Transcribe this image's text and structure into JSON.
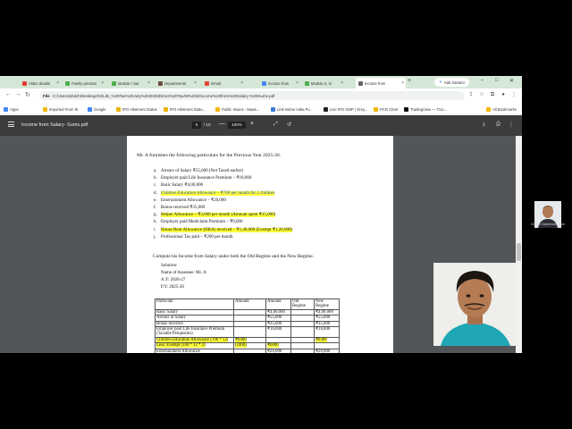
{
  "browser": {
    "tabs": [
      {
        "label": "Video details",
        "color": "#e53935"
      },
      {
        "label": "Family pension",
        "color": "#4caf50"
      },
      {
        "label": "Module I Sal",
        "color": "#4caf50"
      },
      {
        "label": "Departments",
        "color": "#6d4c41"
      },
      {
        "label": "Gmail",
        "color": "#ea4335"
      },
      {
        "label": "Income from",
        "color": "#4285f4"
      },
      {
        "label": "Module 2, In",
        "color": "#4caf50"
      },
      {
        "label": "Income from",
        "color": "#666666"
      }
    ],
    "new_tab": "+",
    "ask_gemini": "Ask Gemini",
    "url_chip": "File",
    "url": "C:/Users/phdch/Desktop/SOL/B_%20Tax%20July%202026/Direct%20Tax/M%202/Income%20from%20Salary-%20Sums.pdf",
    "bookmarks": [
      {
        "label": "Apps"
      },
      {
        "label": "Imported From IE"
      },
      {
        "label": "Google"
      },
      {
        "label": "IPO Allotment Status"
      },
      {
        "label": "IPO Allotment Statu..."
      },
      {
        "label": "Public Issues - Maas..."
      },
      {
        "label": "Link Intime India Pv..."
      },
      {
        "label": "Live IPO GMP | Grey..."
      },
      {
        "label": "PCR Chart"
      },
      {
        "label": "TradingView — Trac..."
      },
      {
        "label": "All Bookmarks"
      }
    ]
  },
  "pdf": {
    "title": "Income from Salary- Sums.pdf",
    "page_current": "6",
    "page_total": "/ 10",
    "zoom": "100%",
    "zoom_minus": "—",
    "zoom_plus": "+"
  },
  "document": {
    "intro": "Mr. A furnishes the following particulars for the Previous Year 2025-26.",
    "items": [
      {
        "label": "a.",
        "text": "Arrears of Salary ₹55,000 (Not Taxed earlier)",
        "hl": ""
      },
      {
        "label": "b.",
        "text": "Employer paid Life Insurance Premium – ₹18,000",
        "hl": ""
      },
      {
        "label": "c.",
        "text": "Basic Salary ₹4,00,000",
        "hl": ""
      },
      {
        "label": "d.",
        "text": "Children Education Allowance – ₹700 per month for 2 children",
        "hl": "yellow-blue"
      },
      {
        "label": "e.",
        "text": "Entertainment Allowance – ₹20,000",
        "hl": ""
      },
      {
        "label": "f.",
        "text": "Bonus received ₹35,000",
        "hl": ""
      },
      {
        "label": "g.",
        "text": "Helper Allowance – ₹3,000 per month (Amount spent ₹15,000)",
        "hl": "yellow"
      },
      {
        "label": "h.",
        "text": "Employer paid Mediclaim Premium – ₹9,000",
        "hl": ""
      },
      {
        "label": "i.",
        "text": "House Rent Allowance (HRA) received – ₹1,40,000 (Exempt ₹1,20,000)",
        "hl": "yellow"
      },
      {
        "label": "j.",
        "text": "Professional Tax paid – ₹200 per month",
        "hl": ""
      }
    ],
    "compute": "Compute his Income from Salary under both the Old Regime and the New Regime.",
    "solution": [
      "Solution:",
      "Name of Assessee: Mr. A",
      "A.Y: 2026-27",
      "P.Y: 2025-26"
    ],
    "table": {
      "headers": [
        "Particular",
        "Amount",
        "Amount",
        "Old Regime",
        "New Regime"
      ],
      "rows": [
        {
          "particular": "Basic Salary",
          "a1": "",
          "a2": "₹4,00,000",
          "old": "",
          "new": "₹4,00,000",
          "hl": ""
        },
        {
          "particular": "Arrears of Salary",
          "a1": "",
          "a2": "₹55,000",
          "old": "",
          "new": "₹55,000",
          "hl": ""
        },
        {
          "particular": "Bonus received",
          "a1": "",
          "a2": "₹35,000",
          "old": "",
          "new": "₹35,000",
          "hl": ""
        },
        {
          "particular": "Employer paid Life Insurance Premium (Taxable Perquisites)",
          "a1": "",
          "a2": "₹18,000",
          "old": "",
          "new": "₹18,000",
          "hl": ""
        },
        {
          "particular": "Children Education Allowance (700 * 12)",
          "a1": "₹8400",
          "a2": "",
          "old": "",
          "new": "₹8400",
          "hl": "yellow"
        },
        {
          "particular": "Less: Exempt (100 * 12 * 2)",
          "a1": "(2400)",
          "a2": "₹6000",
          "old": "",
          "new": "",
          "hl": "yellow"
        },
        {
          "particular": "Entertainment Allowance",
          "a1": "",
          "a2": "₹20,000",
          "old": "",
          "new": "₹20,000",
          "hl": ""
        }
      ]
    }
  },
  "webcam": {
    "small_name": "Chetan Deshmukh Rane"
  },
  "colors": {
    "tabstrip": "#d5e7d6",
    "pdf_toolbar": "#3c3c3c",
    "pdf_bg": "#525659",
    "highlight": "#ffff3a"
  }
}
